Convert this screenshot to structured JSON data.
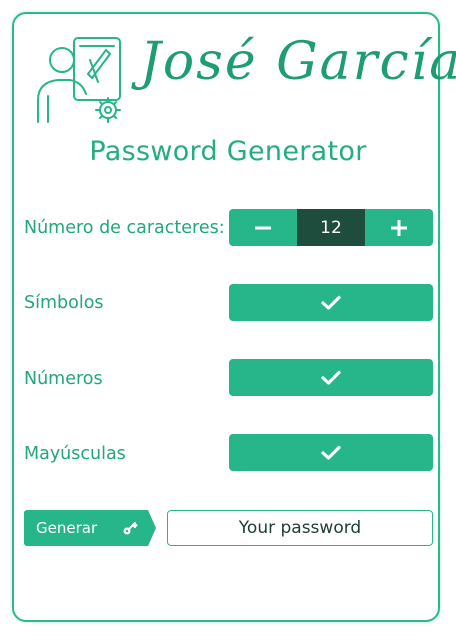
{
  "logo": {
    "name": "José García"
  },
  "title": "Password Generator",
  "length": {
    "label": "Número de caracteres:",
    "value": "12",
    "decrement_icon": "minus-icon",
    "increment_icon": "plus-icon"
  },
  "options": [
    {
      "label": "Símbolos",
      "checked": true,
      "icon": "check-icon"
    },
    {
      "label": "Números",
      "checked": true,
      "icon": "check-icon"
    },
    {
      "label": "Mayúsculas",
      "checked": true,
      "icon": "check-icon"
    }
  ],
  "generate": {
    "label": "Generar",
    "icon": "key-icon"
  },
  "password": {
    "value": "Your password"
  },
  "colors": {
    "accent": "#27b68a",
    "dark": "#1e4d3e",
    "text": "#21a77a"
  }
}
